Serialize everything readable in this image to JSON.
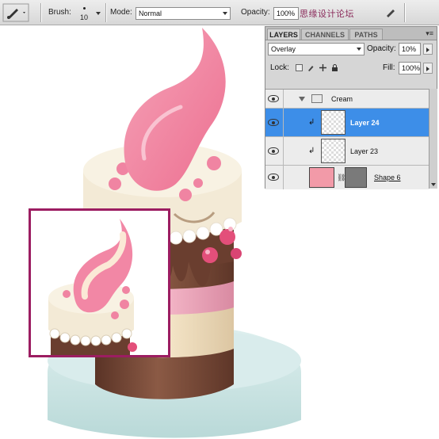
{
  "options_bar": {
    "brush_label": "Brush:",
    "brush_size": "10",
    "mode_label": "Mode:",
    "mode_value": "Normal",
    "opacity_label": "Opacity:",
    "opacity_value": "100%",
    "watermark": "思缘设计论坛"
  },
  "layers_panel": {
    "tabs": [
      "LAYERS",
      "CHANNELS",
      "PATHS"
    ],
    "menu_glyph": "▾≡",
    "blend_mode": "Overlay",
    "opacity_label": "Opacity:",
    "opacity_value": "10%",
    "lock_label": "Lock:",
    "fill_label": "Fill:",
    "fill_value": "100%",
    "layers": [
      {
        "name": "Cream",
        "kind": "group"
      },
      {
        "name": "Layer 24",
        "kind": "clipped",
        "selected": true
      },
      {
        "name": "Layer 23",
        "kind": "clipped"
      },
      {
        "name": "Shape 6",
        "kind": "shape"
      }
    ]
  },
  "colors": {
    "panel_selection": "#3d8ee8",
    "inset_border": "#9c1d61",
    "cream_pink": "#f2839f",
    "chocolate": "#7a4a3a",
    "plate": "#cfe6e6"
  }
}
